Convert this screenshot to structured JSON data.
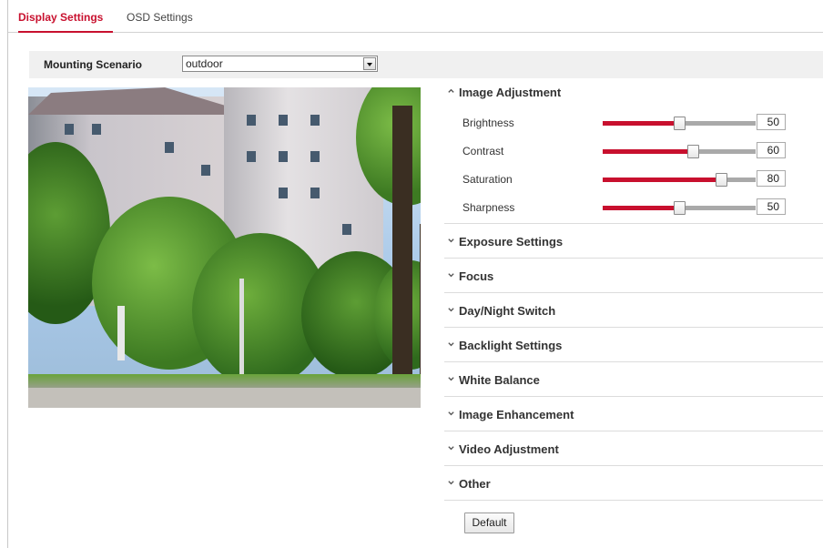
{
  "tabs": {
    "display": "Display Settings",
    "osd": "OSD Settings"
  },
  "scenario": {
    "label": "Mounting Scenario",
    "value": "outdoor"
  },
  "image_adjustment": {
    "title": "Image Adjustment",
    "sliders": [
      {
        "label": "Brightness",
        "value": 50
      },
      {
        "label": "Contrast",
        "value": 60
      },
      {
        "label": "Saturation",
        "value": 80
      },
      {
        "label": "Sharpness",
        "value": 50
      }
    ]
  },
  "sections": [
    "Exposure Settings",
    "Focus",
    "Day/Night Switch",
    "Backlight Settings",
    "White Balance",
    "Image Enhancement",
    "Video Adjustment",
    "Other"
  ],
  "default_label": "Default",
  "colors": {
    "accent": "#c8102e",
    "track": "#a9a9a9"
  },
  "icons": {
    "collapsed": "chevron-down-icon",
    "expanded": "chevron-up-icon"
  }
}
